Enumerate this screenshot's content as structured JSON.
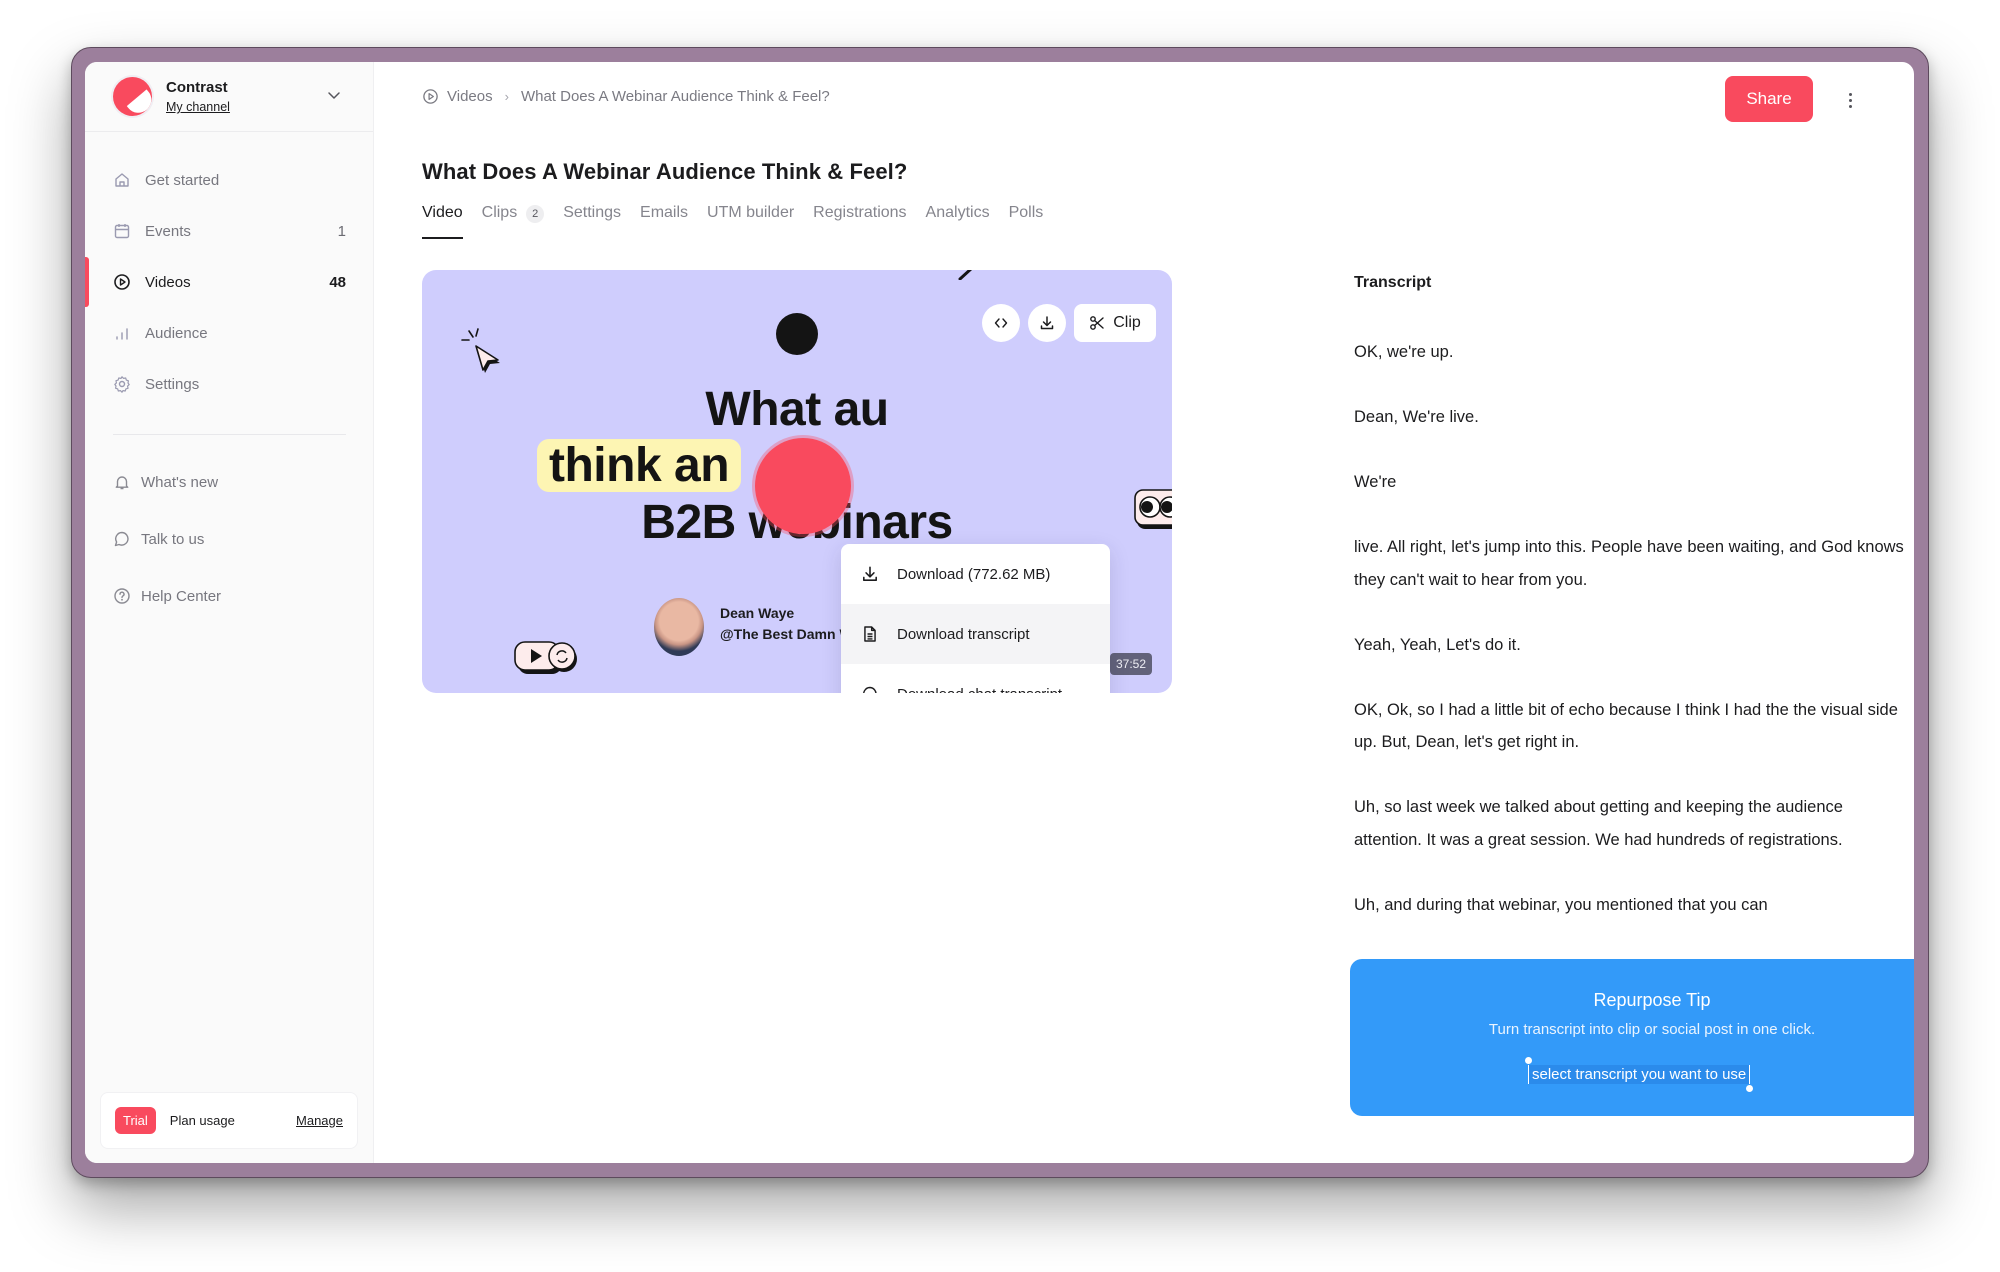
{
  "workspace": {
    "name": "Contrast",
    "channel": "My channel"
  },
  "sidebar": {
    "items": [
      {
        "label": "Get started",
        "icon": "home-icon",
        "count": ""
      },
      {
        "label": "Events",
        "icon": "calendar-icon",
        "count": "1"
      },
      {
        "label": "Videos",
        "icon": "play-circle-icon",
        "count": "48",
        "active": true
      },
      {
        "label": "Audience",
        "icon": "bar-chart-icon",
        "count": ""
      },
      {
        "label": "Settings",
        "icon": "gear-icon",
        "count": ""
      }
    ],
    "secondary": [
      {
        "label": "What's new",
        "icon": "bell-icon"
      },
      {
        "label": "Talk to us",
        "icon": "chat-bubble-icon"
      },
      {
        "label": "Help Center",
        "icon": "help-circle-icon"
      }
    ],
    "plan": {
      "badge": "Trial",
      "label": "Plan usage",
      "action": "Manage"
    }
  },
  "breadcrumb": {
    "root": "Videos",
    "current": "What Does A Webinar Audience Think & Feel?"
  },
  "header": {
    "share_label": "Share"
  },
  "page": {
    "title": "What Does A Webinar Audience Think & Feel?",
    "tabs": [
      {
        "label": "Video",
        "active": true
      },
      {
        "label": "Clips",
        "badge": "2"
      },
      {
        "label": "Settings"
      },
      {
        "label": "Emails"
      },
      {
        "label": "UTM builder"
      },
      {
        "label": "Registrations"
      },
      {
        "label": "Analytics"
      },
      {
        "label": "Polls"
      }
    ]
  },
  "video": {
    "thumbnail_lines": [
      "What au",
      "think an",
      "B2B webinars"
    ],
    "presenter_name": "Dean Waye",
    "presenter_org": "@The Best Damn Webinar Co.",
    "duration": "37:52",
    "clip_label": "Clip",
    "colors": {
      "background": "#cfcdfd",
      "highlight": "#fdf5b3",
      "play": "#f94a5e"
    }
  },
  "download_menu": {
    "items": [
      {
        "label": "Download (772.62 MB)",
        "icon": "download-icon"
      },
      {
        "label": "Download transcript",
        "icon": "document-icon",
        "hovered": true
      },
      {
        "label": "Download chat transcript",
        "icon": "chat-bubble-icon"
      }
    ]
  },
  "transcript": {
    "title": "Transcript",
    "paragraphs": [
      "OK, we're up.",
      "Dean, We're live.",
      "We're",
      "live. All right, let's jump into this. People have been waiting, and God knows they can't wait to hear from you.",
      "Yeah, Yeah, Let's do it.",
      "OK, Ok, so I had a little bit of echo because I think I had the the visual side up. But, Dean, let's get right in.",
      "Uh, so last week we talked about getting and keeping the audience attention. It was a great session. We had hundreds of registrations.",
      "Uh, and during that webinar, you mentioned that you can"
    ]
  },
  "tip": {
    "title": "Repurpose Tip",
    "text": "Turn transcript into clip or social post in one click.",
    "selection": "select transcript you want to use"
  },
  "colors": {
    "accent": "#f94a5e",
    "tip_blue": "#339af9",
    "frame": "#9c7f9c"
  }
}
